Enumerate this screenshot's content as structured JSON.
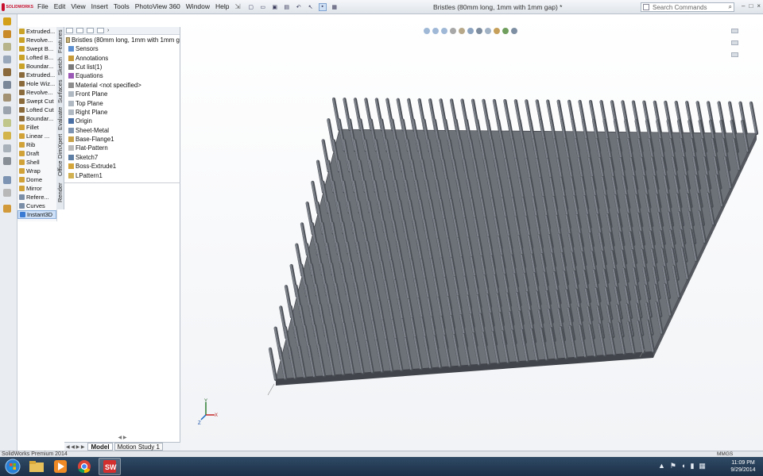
{
  "app": {
    "logo_text": "SOLIDWORKS"
  },
  "menu": [
    "File",
    "Edit",
    "View",
    "Insert",
    "Tools",
    "PhotoView 360",
    "Window",
    "Help"
  ],
  "menu_pin": "⇲",
  "document_title": "Bristles (80mm long, 1mm with 1mm gap) *",
  "search": {
    "placeholder": "Search Commands",
    "icon": "search-icon"
  },
  "window_controls": [
    "–",
    "□",
    "×"
  ],
  "command_list": [
    {
      "label": "Extruded...",
      "color": "#c9a227"
    },
    {
      "label": "Revolve...",
      "color": "#c9a227"
    },
    {
      "label": "Swept B...",
      "color": "#c9a227"
    },
    {
      "label": "Lofted B...",
      "color": "#c9a227"
    },
    {
      "label": "Boundar...",
      "color": "#c9a227"
    },
    {
      "label": "Extruded...",
      "color": "#8a6a3a"
    },
    {
      "label": "Hole Wiz...",
      "color": "#8a6a3a"
    },
    {
      "label": "Revolve...",
      "color": "#8a6a3a"
    },
    {
      "label": "Swept Cut",
      "color": "#8a6a3a"
    },
    {
      "label": "Lofted Cut",
      "color": "#8a6a3a"
    },
    {
      "label": "Boundar...",
      "color": "#8a6a3a"
    },
    {
      "label": "Fillet",
      "color": "#d1a238"
    },
    {
      "label": "Linear ...",
      "color": "#d1a238"
    },
    {
      "label": "Rib",
      "color": "#d1a238"
    },
    {
      "label": "Draft",
      "color": "#d1a238"
    },
    {
      "label": "Shell",
      "color": "#d1a238"
    },
    {
      "label": "Wrap",
      "color": "#d1a238"
    },
    {
      "label": "Dome",
      "color": "#d1a238"
    },
    {
      "label": "Mirror",
      "color": "#d1a238"
    },
    {
      "label": "Refere...",
      "color": "#7b8ea8"
    },
    {
      "label": "Curves",
      "color": "#7b8ea8"
    },
    {
      "label": "Instant3D",
      "color": "#3b7bd4",
      "selected": true
    }
  ],
  "vertical_tabs": [
    "Features",
    "Sketch",
    "Surfaces",
    "Evaluate",
    "DimXpert",
    "Office Products",
    "Render Tools"
  ],
  "feature_tree": {
    "root": "Bristles (80mm long, 1mm with 1mm g",
    "nodes": [
      {
        "label": "Sensors",
        "icon": "sensors-icon"
      },
      {
        "label": "Annotations",
        "icon": "annotations-icon"
      },
      {
        "label": "Cut list(1)",
        "icon": "cutlist-icon"
      },
      {
        "label": "Equations",
        "icon": "equations-icon"
      },
      {
        "label": "Material <not specified>",
        "icon": "material-icon"
      },
      {
        "label": "Front Plane",
        "icon": "plane-icon"
      },
      {
        "label": "Top Plane",
        "icon": "plane-icon"
      },
      {
        "label": "Right Plane",
        "icon": "plane-icon"
      },
      {
        "label": "Origin",
        "icon": "origin-icon"
      },
      {
        "label": "Sheet-Metal",
        "icon": "sheetmetal-icon"
      },
      {
        "label": "Base-Flange1",
        "icon": "flange-icon"
      },
      {
        "label": "Flat-Pattern",
        "icon": "flatpattern-icon"
      },
      {
        "label": "Sketch7",
        "icon": "sketch-icon"
      },
      {
        "label": "Boss-Extrude1",
        "icon": "extrude-icon"
      },
      {
        "label": "LPattern1",
        "icon": "pattern-icon"
      }
    ],
    "scroll_hint": "◀ ▶"
  },
  "bottom_tabs": {
    "arrows": "◀ ◀ ▶ ▶",
    "tabs": [
      "Model",
      "Motion Study 1"
    ]
  },
  "triad": {
    "x": "X",
    "y": "Y",
    "z": "Z"
  },
  "status": {
    "text": "SolidWorks Premium 2014",
    "units": "MMGS"
  },
  "taskbar": {
    "apps": [
      "start-orb",
      "explorer",
      "media-player",
      "chrome",
      "solidworks"
    ],
    "clock_time": "11:09 PM",
    "clock_date": "9/29/2014"
  },
  "colors": {
    "plate_top": "#6d7178",
    "plate_front": "#41454b",
    "bristle": "#7d828a",
    "bristle_dark": "#4a4e55"
  }
}
